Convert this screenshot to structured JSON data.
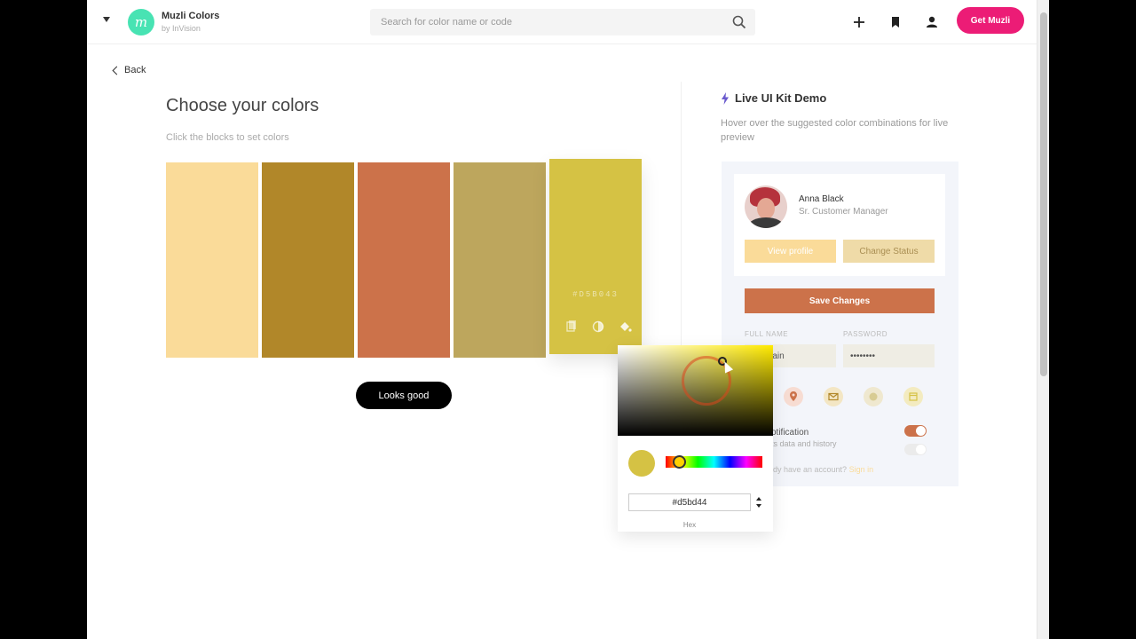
{
  "header": {
    "brand_title": "Muzli Colors",
    "brand_sub": "by InVision",
    "logo_letter": "m",
    "search_placeholder": "Search for color name or code",
    "cta": "Get Muzli"
  },
  "left": {
    "back": "Back",
    "title": "Choose your colors",
    "subtitle": "Click the blocks to set colors",
    "swatches": [
      "#fadb99",
      "#b18729",
      "#cc724a",
      "#bda65d",
      "#d5c244"
    ],
    "active_code": "#D5B043",
    "looks_good": "Looks good"
  },
  "picker": {
    "hex_value": "#d5bd44",
    "hex_label": "Hex"
  },
  "demo": {
    "title": "Live UI Kit Demo",
    "description": "Hover over the suggested color combinations for live preview",
    "person_name": "Anna Black",
    "person_role": "Sr. Customer Manager",
    "view_profile": "View profile",
    "change_status": "Change Status",
    "save_changes": "Save Changes",
    "label_full_name": "FULL NAME",
    "label_password": "PASSWORD",
    "full_name_value": "thy Cain",
    "password_value": "••••••••",
    "notification": "otification",
    "notification_sub": "ts data and history",
    "account_text": "dy have an account?",
    "sign_in": "Sign in"
  },
  "icons": {
    "search": "search-icon",
    "plus": "plus-icon",
    "bookmark": "bookmark-icon",
    "user": "user-icon",
    "bolt": "bolt-icon"
  }
}
